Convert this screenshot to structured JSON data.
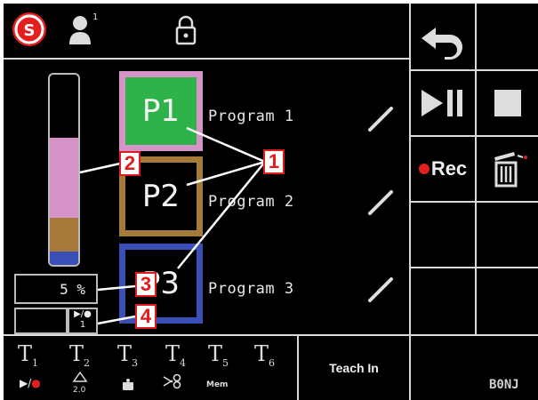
{
  "status_bar": {
    "logo_icon": "brand-logo-icon",
    "user_icon": "user-icon",
    "user_superscript": "1",
    "lock_icon": "padlock-icon"
  },
  "programs": [
    {
      "code": "P1",
      "name": "Program 1",
      "border_color": "#d693c8",
      "fill_color": "#2db34a",
      "edit_icon": "pencil-icon"
    },
    {
      "code": "P2",
      "name": "Program 2",
      "border_color": "#a57a3a",
      "fill_color": "#000000",
      "edit_icon": "pencil-icon"
    },
    {
      "code": "P3",
      "name": "Program 3",
      "border_color": "#3a4fb5",
      "fill_color": "#000000",
      "edit_icon": "pencil-icon"
    }
  ],
  "level_bar": {
    "segments": [
      {
        "color": "#d693c8",
        "fraction": 0.42
      },
      {
        "color": "#a57a3a",
        "fraction": 0.18
      },
      {
        "color": "#3a4fb5",
        "fraction": 0.07
      }
    ]
  },
  "percent_readout": "5 %",
  "mode_indicator": {
    "symbol": "▶/●",
    "value": "1"
  },
  "callouts": [
    "1",
    "2",
    "3",
    "4"
  ],
  "right_panel": {
    "back_icon": "back-arrow-icon",
    "play_pause_icon": "play-pause-icon",
    "stop_icon": "stop-icon",
    "rec_label": "Rec",
    "trash_icon": "trash-icon"
  },
  "tools": [
    {
      "label": "T",
      "index": "1",
      "sub_icon": "play-rec-icon"
    },
    {
      "label": "T",
      "index": "2",
      "sub_icon": "pressure-icon"
    },
    {
      "label": "T",
      "index": "3",
      "sub_icon": "weight-icon"
    },
    {
      "label": "T",
      "index": "4",
      "sub_icon": "scissors-icon"
    },
    {
      "label": "T",
      "index": "5",
      "sub_icon": "mem-icon"
    },
    {
      "label": "T",
      "index": "6",
      "sub_icon": ""
    }
  ],
  "t2_sublabel": "2.0",
  "t5_sublabel": "Mem",
  "teach_in_label": "Teach In",
  "corner_code": "B0NJ",
  "colors": {
    "accent_red": "#e4201f",
    "grid": "#d9d9d9",
    "callout_red": "#e11b1b"
  }
}
